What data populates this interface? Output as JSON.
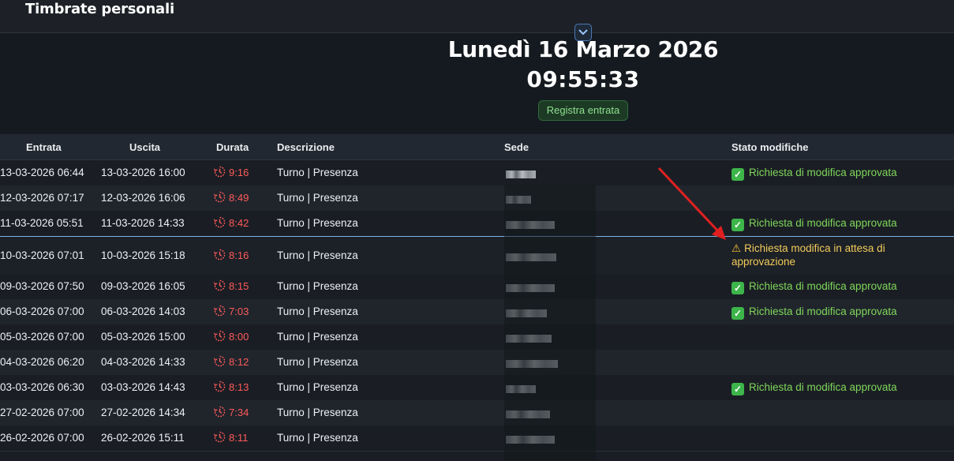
{
  "header": {
    "title": "Timbrate personali"
  },
  "hero": {
    "date": "Lunedì 16 Marzo 2026",
    "time": "09:55:33",
    "register_button": "Registra entrata"
  },
  "table": {
    "columns": {
      "entrata": "Entrata",
      "uscita": "Uscita",
      "durata": "Durata",
      "descrizione": "Descrizione",
      "sede": "Sede",
      "stato": "Stato modifiche"
    },
    "rows": [
      {
        "entrata": "13-03-2026 06:44",
        "uscita": "13-03-2026 16:00",
        "durata": "9:16",
        "descrizione": "Turno | Presenza",
        "stato": "Richiesta di modifica approvata"
      },
      {
        "entrata": "12-03-2026 07:17",
        "uscita": "12-03-2026 16:06",
        "durata": "8:49",
        "descrizione": "Turno | Presenza",
        "stato": ""
      },
      {
        "entrata": "11-03-2026 05:51",
        "uscita": "11-03-2026 14:33",
        "durata": "8:42",
        "descrizione": "Turno | Presenza",
        "stato": "Richiesta di modifica approvata"
      },
      {
        "entrata": "10-03-2026 07:01",
        "uscita": "10-03-2026 15:18",
        "durata": "8:16",
        "descrizione": "Turno | Presenza",
        "stato": "Richiesta modifica in attesa di approvazione"
      },
      {
        "entrata": "09-03-2026 07:50",
        "uscita": "09-03-2026 16:05",
        "durata": "8:15",
        "descrizione": "Turno | Presenza",
        "stato": "Richiesta di modifica approvata"
      },
      {
        "entrata": "06-03-2026 07:00",
        "uscita": "06-03-2026 14:03",
        "durata": "7:03",
        "descrizione": "Turno | Presenza",
        "stato": "Richiesta di modifica approvata"
      },
      {
        "entrata": "05-03-2026 07:00",
        "uscita": "05-03-2026 15:00",
        "durata": "8:00",
        "descrizione": "Turno | Presenza",
        "stato": ""
      },
      {
        "entrata": "04-03-2026 06:20",
        "uscita": "04-03-2026 14:33",
        "durata": "8:12",
        "descrizione": "Turno | Presenza",
        "stato": ""
      },
      {
        "entrata": "03-03-2026 06:30",
        "uscita": "03-03-2026 14:43",
        "durata": "8:13",
        "descrizione": "Turno | Presenza",
        "stato": "Richiesta di modifica approvata"
      },
      {
        "entrata": "27-02-2026 07:00",
        "uscita": "27-02-2026 14:34",
        "durata": "7:34",
        "descrizione": "Turno | Presenza",
        "stato": ""
      },
      {
        "entrata": "26-02-2026 07:00",
        "uscita": "26-02-2026 15:11",
        "durata": "8:11",
        "descrizione": "Turno | Presenza",
        "stato": ""
      }
    ]
  },
  "icons": {
    "collapse": "chevron-down-icon",
    "duration": "clock-history-icon",
    "approved": "check-box-icon",
    "pending": "warning-icon",
    "annotation": "red-arrow"
  },
  "colors": {
    "approved": "#7fd65a",
    "pending": "#f2cc5a",
    "duration": "#ff5a5a",
    "selected_border": "#7fb3e6",
    "arrow": "#e02020"
  }
}
